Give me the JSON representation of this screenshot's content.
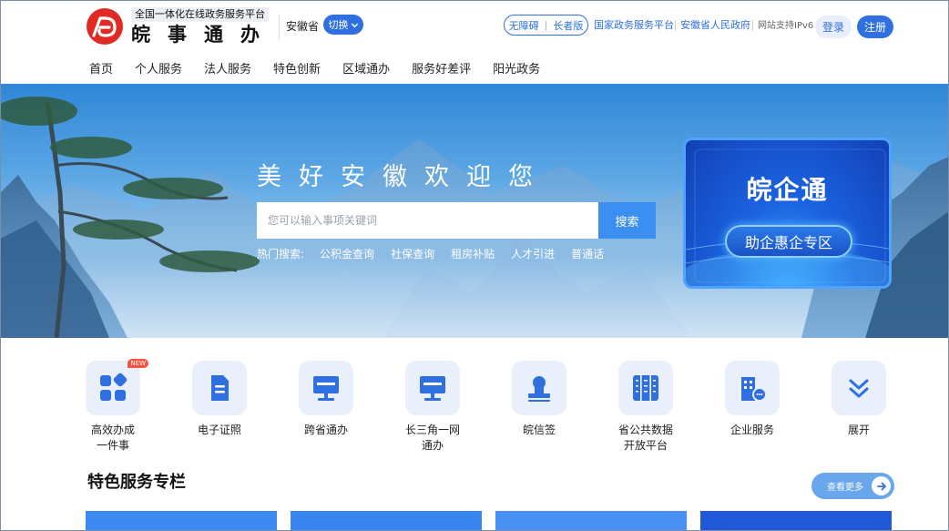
{
  "header": {
    "slogan": "全国一体化在线政务服务平台",
    "brand": "皖事通办",
    "region": "安徽省",
    "switch_label": "切换",
    "access_barrier_free": "无障碍",
    "access_elder": "长者版",
    "link_national": "国家政务服务平台",
    "link_province": "安徽省人民政府",
    "ipv6_text": "网站支持IPv6",
    "login_label": "登录",
    "register_label": "注册"
  },
  "nav": [
    "首页",
    "个人服务",
    "法人服务",
    "特色创新",
    "区域通办",
    "服务好差评",
    "阳光政务"
  ],
  "banner": {
    "title": "美好安徽欢迎您",
    "search_placeholder": "您可以输入事项关键词",
    "search_button": "搜索",
    "hot_label": "热门搜索:",
    "hot_items": [
      "公积金查询",
      "社保查询",
      "租房补贴",
      "人才引进",
      "普通话"
    ],
    "promo_title": "皖企通",
    "promo_button": "助企惠企专区"
  },
  "services": [
    {
      "label": "高效办成\n一件事",
      "icon": "apps-grid-icon",
      "badge": "NEW"
    },
    {
      "label": "电子证照",
      "icon": "document-icon"
    },
    {
      "label": "跨省通办",
      "icon": "monitor-icon"
    },
    {
      "label": "长三角一网\n通办",
      "icon": "monitor-icon"
    },
    {
      "label": "皖信签",
      "icon": "stamp-icon"
    },
    {
      "label": "省公共数据\n开放平台",
      "icon": "cabinet-icon"
    },
    {
      "label": "企业服务",
      "icon": "enterprise-icon"
    },
    {
      "label": "展开",
      "icon": "chevron-double-down-icon"
    }
  ],
  "section": {
    "title": "特色服务专栏",
    "more_label": "查看更多"
  },
  "colors": {
    "primary": "#2f6fe0",
    "accent_light": "#e9f0fb",
    "badge": "#f4543e",
    "logo_red": "#e02a24"
  }
}
